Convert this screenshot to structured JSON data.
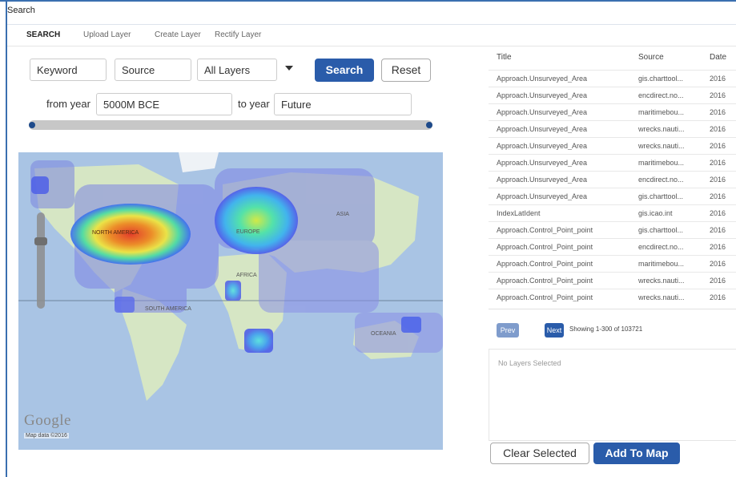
{
  "window": {
    "title": "Search"
  },
  "tabs": [
    {
      "label": "SEARCH",
      "active": true
    },
    {
      "label": "Upload Layer",
      "active": false
    },
    {
      "label": "Create Layer",
      "active": false
    },
    {
      "label": "Rectify Layer",
      "active": false
    }
  ],
  "search": {
    "keyword_placeholder": "Keyword",
    "source_placeholder": "Source",
    "layers_selected": "All Layers",
    "search_label": "Search",
    "reset_label": "Reset",
    "from_label": "from year",
    "from_value": "5000M BCE",
    "to_label": "to year",
    "to_value": "Future"
  },
  "map": {
    "labels": {
      "north_america": "North America",
      "europe": "Europe",
      "asia": "Asia",
      "africa": "Africa",
      "south_america": "South America",
      "oceania": "Oceania"
    },
    "google_logo": "Google",
    "attribution": "Map data ©2016"
  },
  "results": {
    "headers": {
      "title": "Title",
      "source": "Source",
      "date": "Date"
    },
    "rows": [
      {
        "title": "Approach.Unsurveyed_Area",
        "source": "gis.charttool...",
        "date": "2016"
      },
      {
        "title": "Approach.Unsurveyed_Area",
        "source": "encdirect.no...",
        "date": "2016"
      },
      {
        "title": "Approach.Unsurveyed_Area",
        "source": "maritimebou...",
        "date": "2016"
      },
      {
        "title": "Approach.Unsurveyed_Area",
        "source": "wrecks.nauti...",
        "date": "2016"
      },
      {
        "title": "Approach.Unsurveyed_Area",
        "source": "wrecks.nauti...",
        "date": "2016"
      },
      {
        "title": "Approach.Unsurveyed_Area",
        "source": "maritimebou...",
        "date": "2016"
      },
      {
        "title": "Approach.Unsurveyed_Area",
        "source": "encdirect.no...",
        "date": "2016"
      },
      {
        "title": "Approach.Unsurveyed_Area",
        "source": "gis.charttool...",
        "date": "2016"
      },
      {
        "title": "IndexLatIdent",
        "source": "gis.icao.int",
        "date": "2016"
      },
      {
        "title": "Approach.Control_Point_point",
        "source": "gis.charttool...",
        "date": "2016"
      },
      {
        "title": "Approach.Control_Point_point",
        "source": "encdirect.no...",
        "date": "2016"
      },
      {
        "title": "Approach.Control_Point_point",
        "source": "maritimebou...",
        "date": "2016"
      },
      {
        "title": "Approach.Control_Point_point",
        "source": "wrecks.nauti...",
        "date": "2016"
      },
      {
        "title": "Approach.Control_Point_point",
        "source": "wrecks.nauti...",
        "date": "2016"
      }
    ],
    "prev_label": "Prev",
    "next_label": "Next",
    "showing_text": "Showing 1-300 of 103721"
  },
  "selection": {
    "empty_text": "No Layers Selected",
    "clear_label": "Clear Selected",
    "add_label": "Add To Map"
  },
  "colors": {
    "primary": "#2a5caa",
    "prev_disabled": "#7f9ccc",
    "ocean": "#a9c4e4",
    "land": "#d6e6c4"
  }
}
